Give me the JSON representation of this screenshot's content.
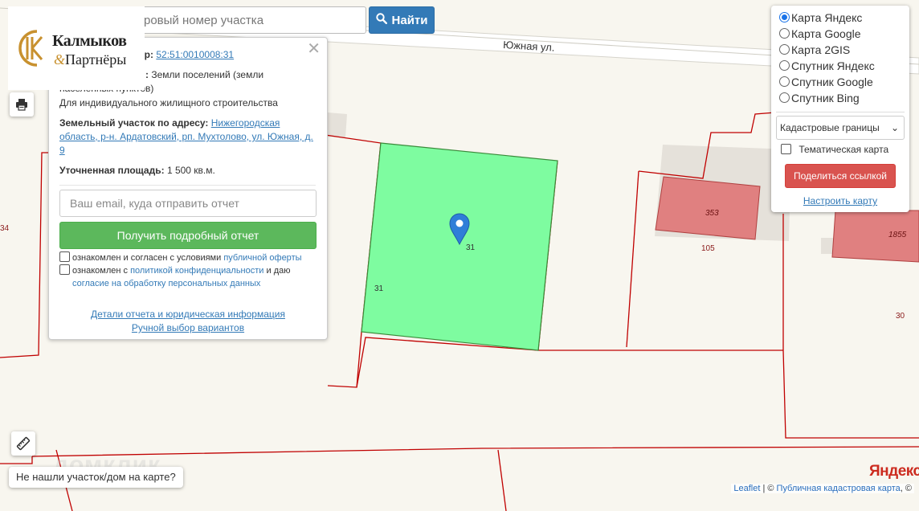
{
  "map": {
    "road_name": "Южная ул.",
    "parcel_number": "31",
    "parcel_label_inner": "31",
    "label_34": "34",
    "label_353": "353",
    "label_105": "105",
    "label_1855": "1855",
    "label_30": "30",
    "watermark": "домклик",
    "colors": {
      "selected_parcel": "#7efca0",
      "building": "#e08080",
      "boundary": "#c00000",
      "marker": "#2f7ed8"
    }
  },
  "search": {
    "placeholder": "ровый номер участка",
    "button_label": "Найти",
    "button_icon": "search-icon"
  },
  "logo": {
    "name": "Калмыков",
    "amp": "&",
    "sub": "Партнёры"
  },
  "popup": {
    "cad_label": "ер:",
    "cad_value": "52:51:0010008:31",
    "category_label": ":",
    "category_value": "Земли поселений (земли",
    "category_value2": "населенных пунктов)",
    "use_value": "Для индивидуального жилищного строительства",
    "address_label": "Земельный участок по адресу:",
    "address_value": "Нижегородская область, р-н. Ардатовский, рп. Мухтолово, ул. Южная, д. 9",
    "area_label": "Уточненная площадь:",
    "area_value": "1 500 кв.м.",
    "email_placeholder": "Ваш email, куда отправить отчет",
    "report_button": "Получить подробный отчет",
    "consent1_text": "ознакомлен и согласен с условиями",
    "consent1_link": "публичной оферты",
    "consent2_text": "ознакомлен с",
    "consent2_link": "политикой конфиденциальности",
    "consent2_mid": "и даю",
    "consent2_link2": "согласие на обработку персональных данных",
    "details_link": "Детали отчета и юридическая информация",
    "manual_link": "Ручной выбор вариантов"
  },
  "layers": {
    "options": [
      {
        "label": "Карта Яндекс",
        "selected": true
      },
      {
        "label": "Карта Google",
        "selected": false
      },
      {
        "label": "Карта 2GIS",
        "selected": false
      },
      {
        "label": "Спутник Яндекс",
        "selected": false
      },
      {
        "label": "Спутник Google",
        "selected": false
      },
      {
        "label": "Спутник Bing",
        "selected": false
      }
    ],
    "overlay_selected": "Кадастровые границы",
    "thematic_label": "Тематическая карта",
    "share_button": "Поделиться ссылкой",
    "setup_link": "Настроить карту"
  },
  "bottom": {
    "not_found": "Не нашли участок/дом на карте?",
    "yandex": "Яндекс",
    "leaflet": "Leaflet",
    "sep": "|",
    "copyright": "©",
    "pkk": "Публичная кадастровая карта",
    "copyright2": ", ©"
  }
}
